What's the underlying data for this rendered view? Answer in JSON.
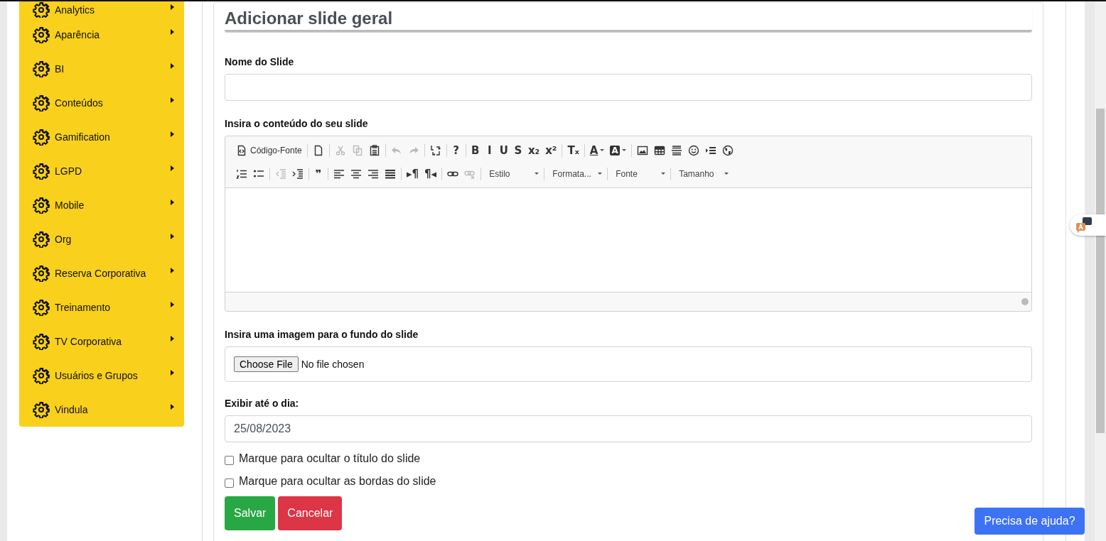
{
  "sidebar": {
    "items": [
      {
        "label": "Analytics"
      },
      {
        "label": "Aparência"
      },
      {
        "label": "BI"
      },
      {
        "label": "Conteúdos"
      },
      {
        "label": "Gamification"
      },
      {
        "label": "LGPD"
      },
      {
        "label": "Mobile"
      },
      {
        "label": "Org"
      },
      {
        "label": "Reserva Corporativa"
      },
      {
        "label": "Treinamento"
      },
      {
        "label": "TV Corporativa"
      },
      {
        "label": "Usuários e Grupos"
      },
      {
        "label": "Vindula"
      }
    ]
  },
  "form": {
    "title": "Adicionar slide geral",
    "name_label": "Nome do Slide",
    "content_label": "Insira o conteúdo do seu slide",
    "editor": {
      "toolbar": [
        [
          [
            {
              "kind": "source",
              "label": "Código-Fonte",
              "disabled": false
            }
          ],
          [
            {
              "kind": "new-page",
              "disabled": false
            }
          ],
          [
            {
              "kind": "cut",
              "disabled": true
            },
            {
              "kind": "copy",
              "disabled": true
            },
            {
              "kind": "paste",
              "disabled": false
            }
          ],
          [
            {
              "kind": "undo",
              "disabled": true
            },
            {
              "kind": "redo",
              "disabled": true
            }
          ],
          [
            {
              "kind": "replace",
              "disabled": false
            }
          ],
          [
            {
              "kind": "glyph",
              "glyph": "?",
              "disabled": false
            }
          ],
          [
            {
              "kind": "glyph",
              "glyph": "B",
              "disabled": false
            },
            {
              "kind": "glyph",
              "glyph": "I",
              "disabled": false
            },
            {
              "kind": "glyph",
              "glyph": "U",
              "disabled": false
            },
            {
              "kind": "glyph",
              "glyph": "S",
              "disabled": false
            },
            {
              "kind": "glyph",
              "glyph": "x₂",
              "disabled": false
            },
            {
              "kind": "glyph",
              "glyph": "x²",
              "disabled": false
            }
          ],
          [
            {
              "kind": "glyph",
              "glyph": "Tₓ",
              "disabled": false
            }
          ],
          [
            {
              "kind": "color",
              "glyph": "A",
              "disabled": false
            },
            {
              "kind": "bgcolor",
              "glyph": "A",
              "disabled": false
            }
          ],
          [
            {
              "kind": "image",
              "disabled": false
            },
            {
              "kind": "table",
              "disabled": false
            },
            {
              "kind": "hr",
              "disabled": false
            },
            {
              "kind": "smiley",
              "disabled": false
            },
            {
              "kind": "blocks",
              "disabled": false
            },
            {
              "kind": "globe",
              "disabled": false
            }
          ]
        ],
        [
          [
            {
              "kind": "numbered",
              "disabled": false
            },
            {
              "kind": "bulleted",
              "disabled": false
            }
          ],
          [
            {
              "kind": "outdent",
              "disabled": true
            },
            {
              "kind": "indent",
              "disabled": false
            }
          ],
          [
            {
              "kind": "glyph",
              "glyph": "❞",
              "disabled": false
            }
          ],
          [
            {
              "kind": "align-left",
              "disabled": false
            },
            {
              "kind": "align-center",
              "disabled": false
            },
            {
              "kind": "align-right",
              "disabled": false
            },
            {
              "kind": "justify",
              "disabled": false
            }
          ],
          [
            {
              "kind": "glyph",
              "glyph": "▸¶",
              "disabled": false
            },
            {
              "kind": "glyph",
              "glyph": "¶◂",
              "disabled": false
            }
          ],
          [
            {
              "kind": "link",
              "disabled": false
            },
            {
              "kind": "unlink",
              "disabled": true
            }
          ],
          [
            {
              "kind": "dropdown",
              "label": "Estilo",
              "disabled": false
            }
          ],
          [
            {
              "kind": "dropdown",
              "label": "Formata...",
              "disabled": false
            }
          ],
          [
            {
              "kind": "dropdown",
              "label": "Fonte",
              "disabled": false
            }
          ],
          [
            {
              "kind": "dropdown",
              "label": "Tamanho",
              "disabled": false
            }
          ]
        ]
      ]
    },
    "image_label": "Insira uma imagem para o fundo do slide",
    "file_button": "Choose File",
    "file_status": "No file chosen",
    "date_label": "Exibir até o dia:",
    "date_value": "25/08/2023",
    "checkboxes": [
      {
        "label": "Marque para ocultar o título do slide",
        "checked": false
      },
      {
        "label": "Marque para ocultar as bordas do slide",
        "checked": false
      }
    ],
    "buttons": [
      {
        "label": "Salvar",
        "kind": "primary"
      },
      {
        "label": "Cancelar",
        "kind": "danger"
      }
    ]
  },
  "help_button": "Precisa de ajuda?"
}
